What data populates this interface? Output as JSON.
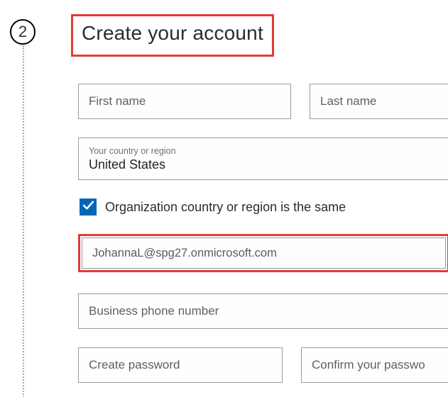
{
  "step": {
    "number": "2"
  },
  "heading": "Create your account",
  "fields": {
    "first_name_placeholder": "First name",
    "last_name_placeholder": "Last name",
    "country_label": "Your country or region",
    "country_value": "United States",
    "org_same_label": "Organization country or region is the same",
    "email_value": "JohannaL@spg27.onmicrosoft.com",
    "phone_placeholder": "Business phone number",
    "password_placeholder": "Create password",
    "confirm_placeholder": "Confirm your passwo"
  },
  "colors": {
    "highlight": "#e13b3b",
    "accent": "#0067b8"
  }
}
